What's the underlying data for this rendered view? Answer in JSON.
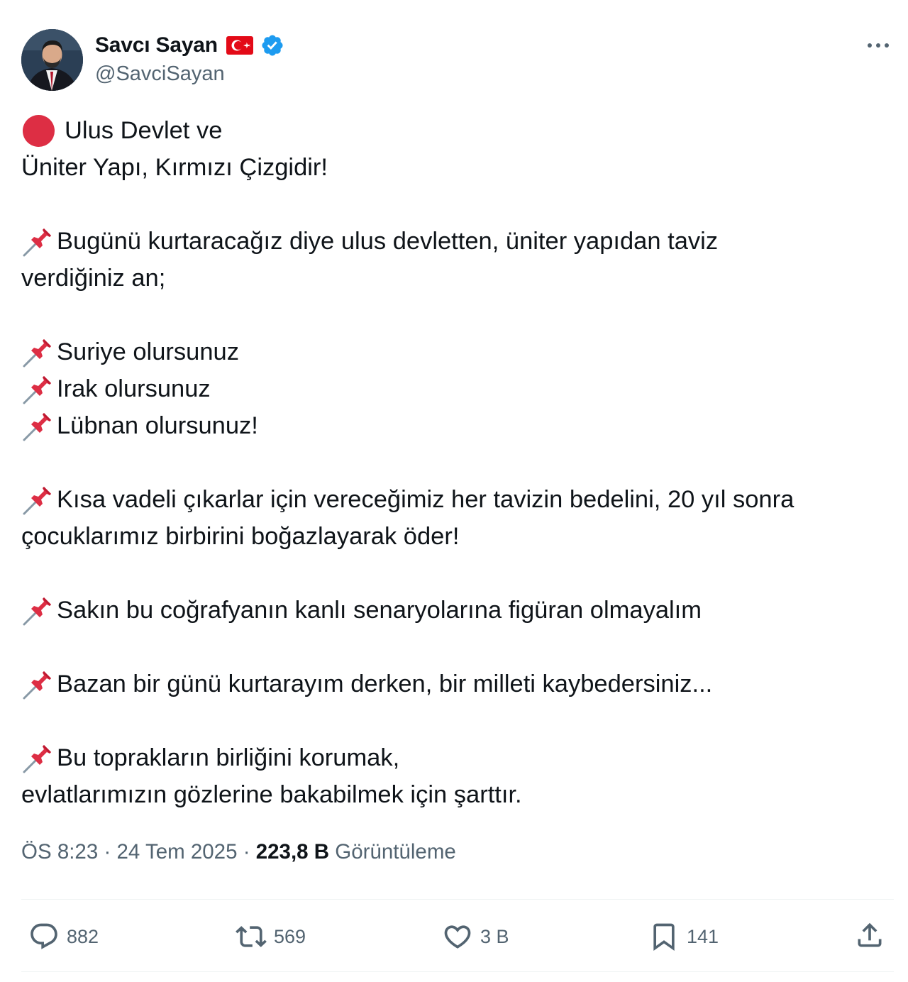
{
  "author": {
    "display_name": "Savcı Sayan",
    "handle": "@SavciSayan",
    "flag_icon": "turkey-flag-icon",
    "verified_icon": "verified-badge-icon",
    "verified_color": "#1d9bf0"
  },
  "tweet": {
    "lines": [
      "Ulus Devlet ve",
      "Üniter Yapı, Kırmızı Çizgidir!",
      "Bugünü kurtaracağız diye ulus devletten, üniter yapıdan taviz",
      "verdiğiniz an;",
      "Suriye olursunuz",
      "Irak olursunuz",
      "Lübnan olursunuz!",
      "Kısa vadeli çıkarlar için vereceğimiz her tavizin bedelini, 20 yıl sonra",
      "çocuklarımız birbirini boğazlayarak öder!",
      "Sakın bu coğrafyanın kanlı senaryolarına figüran olmayalım",
      "Bazan bir günü kurtarayım derken, bir milleti kaybedersiniz...",
      "Bu toprakların birliğini korumak,",
      "evlatlarımızın gözlerine bakabilmek için şarttır."
    ]
  },
  "meta": {
    "time": "ÖS 8:23",
    "separator": "·",
    "date": "24 Tem 2025",
    "views_count": "223,8 B",
    "views_label": "Görüntüleme"
  },
  "actions": {
    "replies": "882",
    "reposts": "569",
    "likes": "3 B",
    "bookmarks": "141"
  },
  "colors": {
    "text": "#0f1419",
    "secondary": "#536471",
    "red_circle": "#dd2e44",
    "flag_red": "#e30a17"
  }
}
